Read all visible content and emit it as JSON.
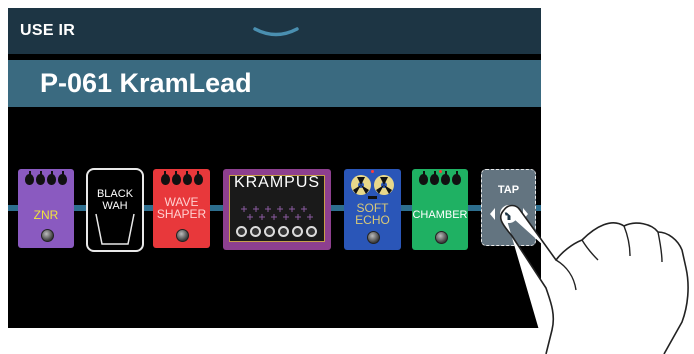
{
  "header": {
    "title": "USE IR",
    "chevron_icon": "chevron-down-icon"
  },
  "patch": {
    "name": "P-061 KramLead"
  },
  "effects": [
    {
      "label": "ZNR",
      "color": "#8a5ac0"
    },
    {
      "label_lines": [
        "BLACK",
        "WAH"
      ],
      "color": "#000000"
    },
    {
      "label_lines": [
        "WAVE",
        "SHAPER"
      ],
      "color": "#e8383b"
    },
    {
      "label": "KRAMPUS",
      "color": "#8d3f8f"
    },
    {
      "label_lines": [
        "SOFT",
        "ECHO"
      ],
      "color": "#2a56b8"
    },
    {
      "label": "CHAMBER",
      "color": "#1fb163"
    }
  ],
  "tap_button": {
    "label": "TAP",
    "icons": [
      "chevron-left-icon",
      "add-icon",
      "chevron-right-icon"
    ]
  },
  "colors": {
    "topbar": "#1d3544",
    "name_bar": "#3a6a80",
    "signal_line": "#2d6e8e",
    "screen_bg": "#000000"
  }
}
